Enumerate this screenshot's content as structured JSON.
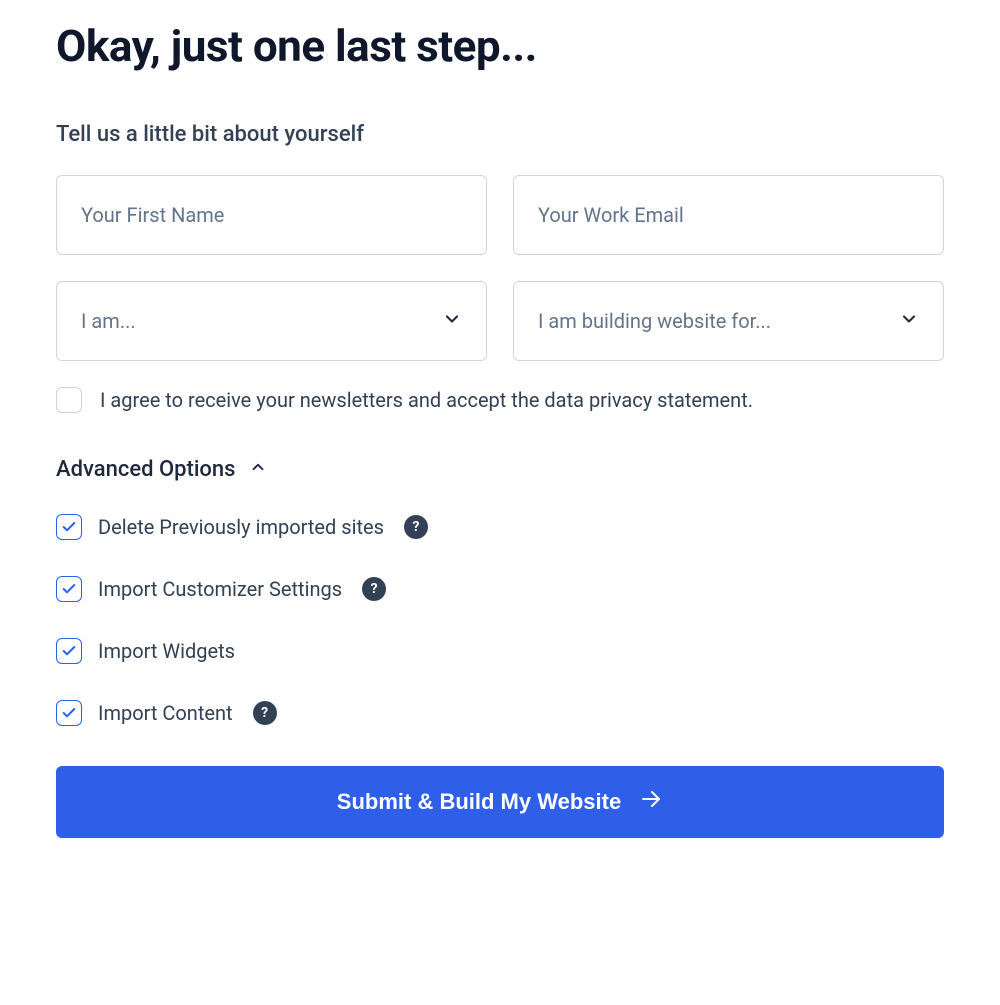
{
  "heading": "Okay, just one last step...",
  "subheading": "Tell us a little bit about yourself",
  "form": {
    "first_name_placeholder": "Your First Name",
    "email_placeholder": "Your Work Email",
    "role_placeholder": "I am...",
    "building_for_placeholder": "I am building website for..."
  },
  "consent": {
    "checked": false,
    "label": "I agree to receive your newsletters and accept the data privacy statement."
  },
  "advanced": {
    "heading": "Advanced Options",
    "expanded": true,
    "options": [
      {
        "label": "Delete Previously imported sites",
        "checked": true,
        "help": true
      },
      {
        "label": "Import Customizer Settings",
        "checked": true,
        "help": true
      },
      {
        "label": "Import Widgets",
        "checked": true,
        "help": false
      },
      {
        "label": "Import Content",
        "checked": true,
        "help": true
      }
    ]
  },
  "submit_label": "Submit & Build My Website"
}
